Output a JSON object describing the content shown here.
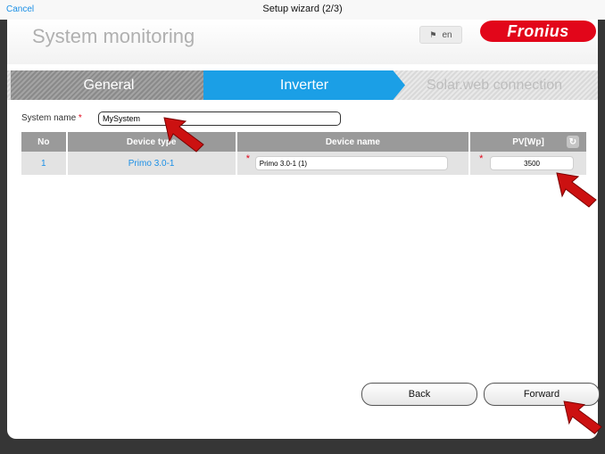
{
  "top_bar": {
    "cancel_label": "Cancel",
    "title": "Setup wizard (2/3)"
  },
  "header": {
    "page_title": "System monitoring",
    "language": "en",
    "logo_text": "Fronius"
  },
  "steps": [
    {
      "label": "General",
      "state": "completed"
    },
    {
      "label": "Inverter",
      "state": "active"
    },
    {
      "label": "Solar.web connection",
      "state": "pending"
    }
  ],
  "system_name": {
    "label": "System name",
    "value": "MySystem"
  },
  "table": {
    "headers": [
      "No",
      "Device type",
      "Device name",
      "PV[Wp]"
    ],
    "rows": [
      {
        "no": "1",
        "device_type": "Primo 3.0-1",
        "device_name": "Primo 3.0-1 (1)",
        "pv": "3500"
      }
    ]
  },
  "buttons": {
    "back": "Back",
    "forward": "Forward"
  },
  "colors": {
    "accent": "#1b9fe6",
    "brand": "#e2061a",
    "pointer": "#cc1111"
  }
}
